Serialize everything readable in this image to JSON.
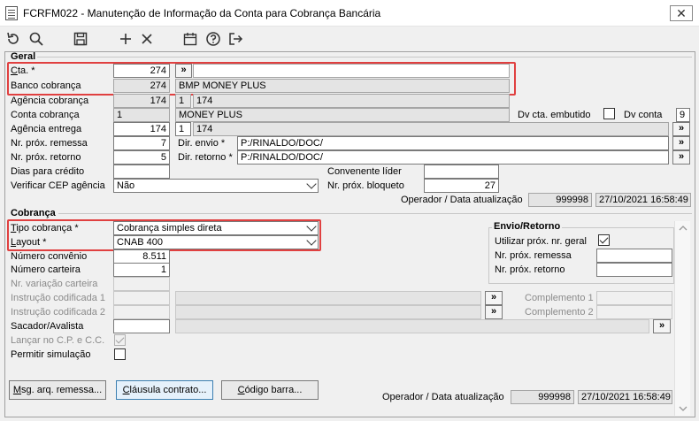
{
  "window": {
    "title": "FCRFM022 - Manutenção de Informação da Conta para Cobrança Bancária",
    "close_glyph": "✕"
  },
  "toolbar": {
    "icons": [
      "undo-icon",
      "search-icon",
      "save-icon",
      "add-icon",
      "delete-icon",
      "calendar-icon",
      "help-icon",
      "exit-icon"
    ]
  },
  "geral": {
    "section_title": "Geral",
    "cta_label": "Cta. *",
    "cta_value": "274",
    "banco_label": "Banco cobrança",
    "banco_value": "274",
    "banco_name": "BMP MONEY PLUS",
    "agencia_cobranca_label": "Agência cobrança",
    "agencia_cobranca_value": "174",
    "agencia_cobranca_dv": "1",
    "agencia_cobranca_desc": "174",
    "conta_cobranca_label": "Conta cobrança",
    "conta_cobranca_value": "1",
    "conta_cobranca_desc": "MONEY PLUS",
    "dv_cta_embutido_label": "Dv cta. embutido",
    "dv_conta_label": "Dv conta",
    "dv_conta_value": "9",
    "agencia_entrega_label": "Agência entrega",
    "agencia_entrega_value": "174",
    "agencia_entrega_dv": "1",
    "agencia_entrega_desc": "174",
    "nr_prox_remessa_label": "Nr. próx. remessa",
    "nr_prox_remessa_value": "7",
    "nr_prox_retorno_label": "Nr. próx. retorno",
    "nr_prox_retorno_value": "5",
    "dir_envio_label": "Dir. envio *",
    "dir_envio_value": "P:/RINALDO/DOC/",
    "dir_retorno_label": "Dir. retorno *",
    "dir_retorno_value": "P:/RINALDO/DOC/",
    "dias_credito_label": "Dias para crédito",
    "dias_credito_value": "",
    "convenente_label": "Convenente líder",
    "convenente_value": "",
    "verificar_cep_label": "Verificar CEP agência",
    "verificar_cep_value": "Não",
    "nr_prox_bloqueto_label": "Nr. próx. bloqueto",
    "nr_prox_bloqueto_value": "27",
    "operador_label": "Operador / Data atualização",
    "operador_value": "999998",
    "data_value": "27/10/2021 16:58:49",
    "lookup_btn": "»"
  },
  "cobranca": {
    "section_title": "Cobrança",
    "tipo_label": "Tipo cobrança *",
    "tipo_value": "Cobrança simples direta",
    "layout_label": "Layout *",
    "layout_value": "CNAB 400",
    "numero_convenio_label": "Número convênio",
    "numero_convenio_value": "8.511",
    "numero_carteira_label": "Número carteira",
    "numero_carteira_value": "1",
    "nr_variacao_label": "Nr. variação carteira",
    "instrucao1_label": "Instrução codificada 1",
    "instrucao2_label": "Instrução codificada 2",
    "complemento1_label": "Complemento 1",
    "complemento2_label": "Complemento 2",
    "sacador_label": "Sacador/Avalista",
    "lancar_label": "Lançar no C.P. e C.C.",
    "permitir_label": "Permitir simulação",
    "envio_retorno_title": "Envio/Retorno",
    "utilizar_label": "Utilizar próx. nr. geral",
    "nr_prox_remessa_label": "Nr. próx. remessa",
    "nr_prox_retorno_label": "Nr. próx. retorno",
    "msg_btn": "Msg. arq. remessa...",
    "clausula_btn": "Cláusula contrato...",
    "codigo_btn": "Código barra...",
    "operador_label": "Operador / Data atualização",
    "operador_value": "999998",
    "data_value": "27/10/2021 16:58:49"
  },
  "colors": {
    "highlight": "#e04040",
    "window_bg": "#f0f0f0",
    "readonly_bg": "#e4e4e4"
  }
}
